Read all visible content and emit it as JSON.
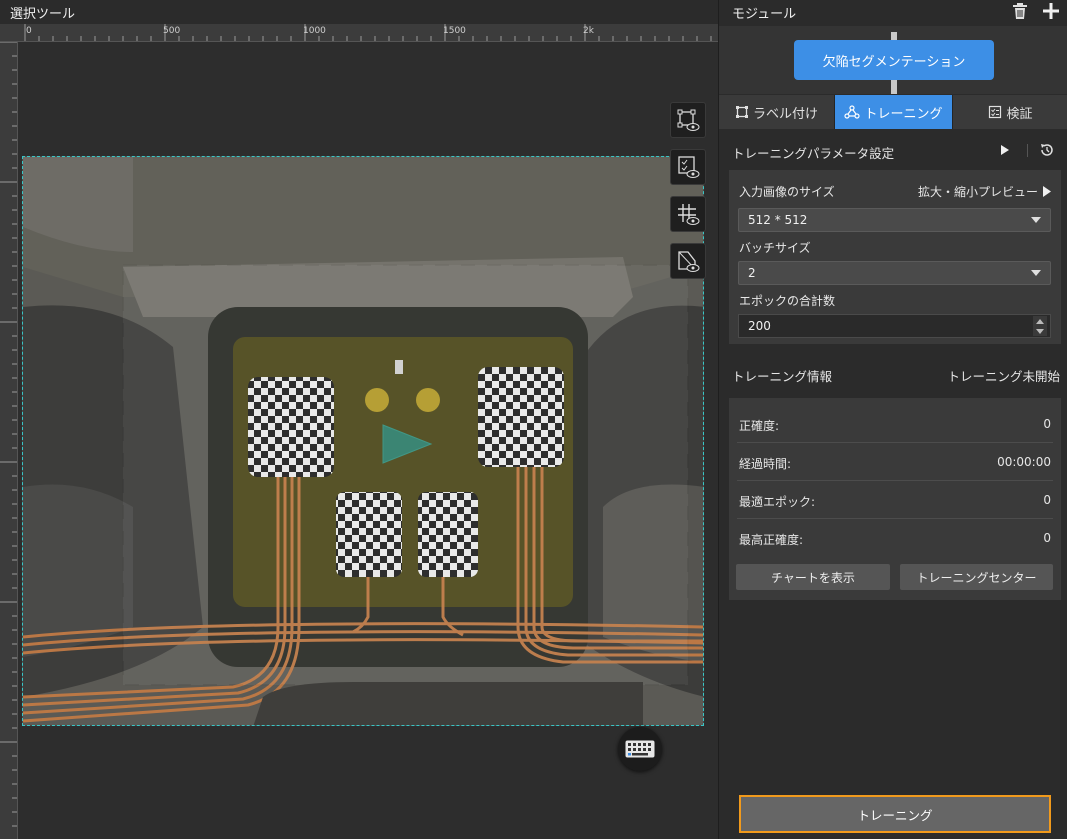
{
  "left_panel": {
    "title": "選択ツール",
    "ruler_ticks": [
      "0",
      "500",
      "1000",
      "1500",
      "2k"
    ]
  },
  "right_panel": {
    "title": "モジュール",
    "module_button": "欠陥セグメンテーション",
    "tabs": [
      {
        "label": "ラベル付け",
        "icon": "label-icon",
        "active": false
      },
      {
        "label": "トレーニング",
        "icon": "training-icon",
        "active": true
      },
      {
        "label": "検証",
        "icon": "validate-icon",
        "active": false
      }
    ],
    "params": {
      "title": "トレーニングパラメータ設定",
      "input_size_label": "入力画像のサイズ",
      "zoom_preview_label": "拡大・縮小プレビュー",
      "input_size_value": "512 * 512",
      "batch_label": "バッチサイズ",
      "batch_value": "2",
      "epoch_label": "エポックの合計数",
      "epoch_value": "200"
    },
    "info": {
      "title": "トレーニング情報",
      "status": "トレーニング未開始",
      "rows": [
        {
          "label": "正確度:",
          "value": "0"
        },
        {
          "label": "経過時間:",
          "value": "00:00:00"
        },
        {
          "label": "最適エポック:",
          "value": "0"
        },
        {
          "label": "最高正確度:",
          "value": "0"
        }
      ],
      "show_chart_button": "チャートを表示",
      "training_center_button": "トレーニングセンター"
    },
    "train_button": "トレーニング"
  },
  "colors": {
    "accent": "#3d8fe6",
    "focus_border": "#f19a1c",
    "selection_border": "#38c6c6"
  }
}
